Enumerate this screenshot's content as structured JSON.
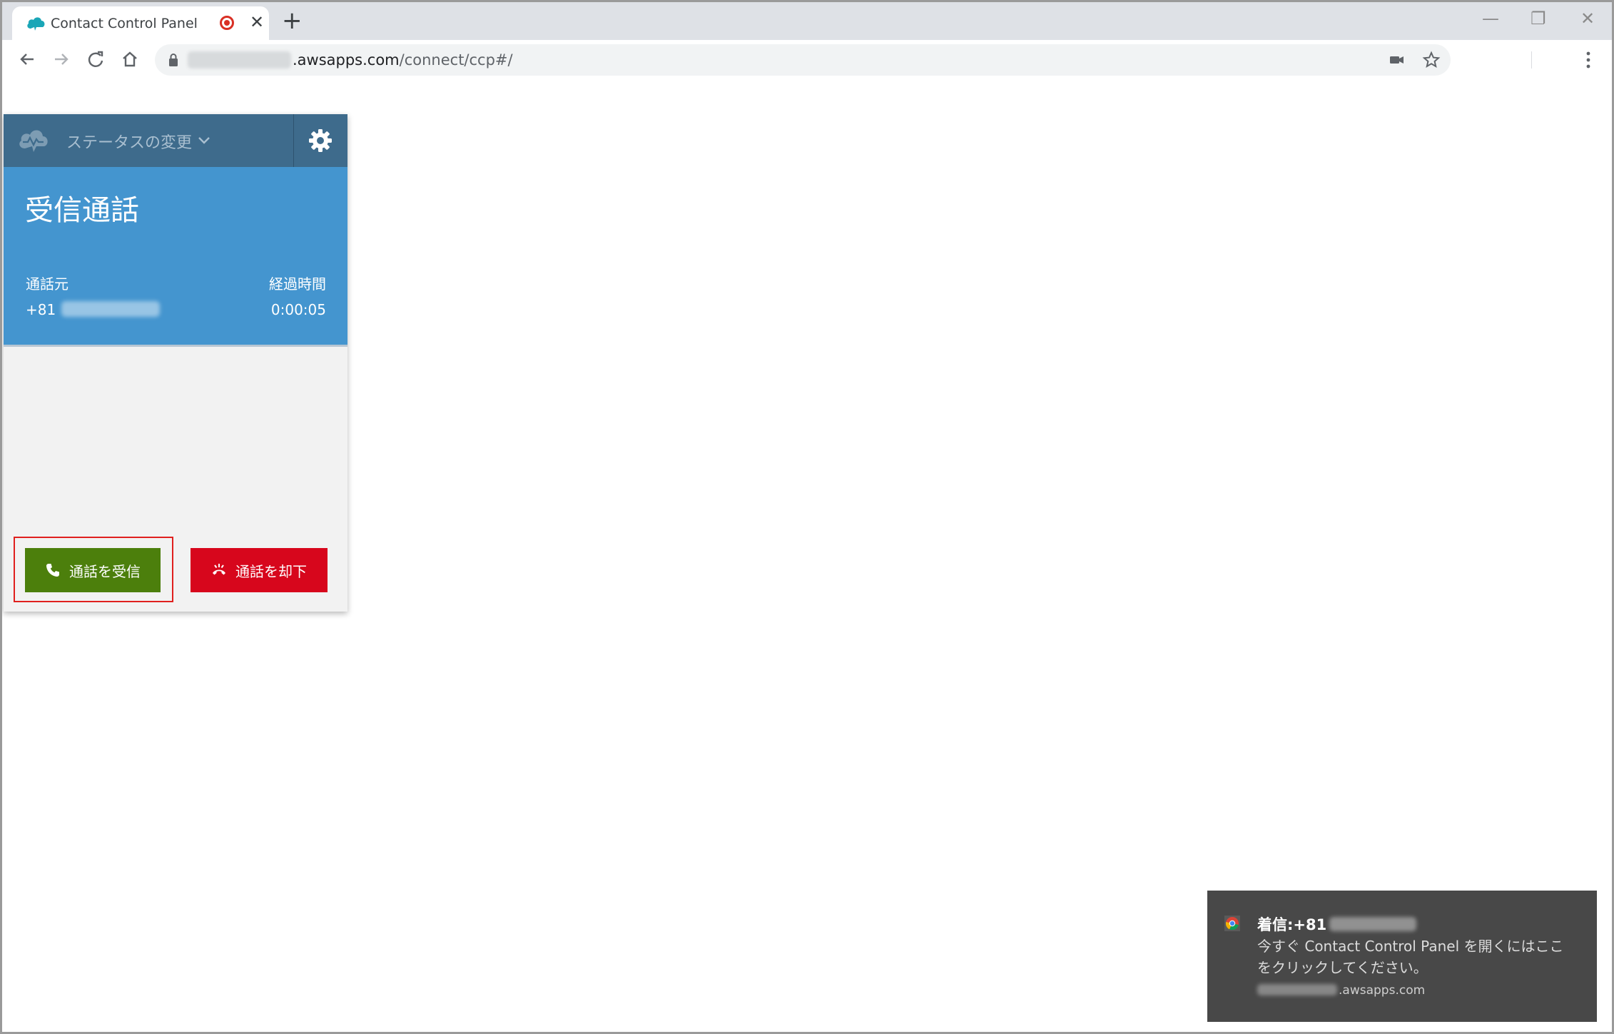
{
  "browser": {
    "tab": {
      "title": "Contact Control Panel",
      "favicon": "aws-connect-cloud-icon",
      "recording_icon": "record-icon",
      "close_icon": "close-icon"
    },
    "new_tab_icon": "plus-icon",
    "window_controls": [
      "minimize-icon",
      "restore-icon",
      "close-icon"
    ],
    "address_bar": {
      "host_blurred": "test-connect1",
      "host": ".awsapps.com",
      "path": "/connect/ccp#/"
    },
    "toolbar_icons": [
      "back-icon",
      "forward-icon",
      "reload-icon",
      "home-icon",
      "lock-icon",
      "camera-icon",
      "star-icon",
      "menu-icon"
    ]
  },
  "ccp": {
    "header": {
      "status_label": "ステータスの変更",
      "settings_icon": "gear-icon"
    },
    "call": {
      "title": "受信通話",
      "from_label": "通話元",
      "from_prefix": "+81",
      "elapsed_label": "経過時間",
      "elapsed_time": "0:00:05"
    },
    "actions": {
      "accept_label": "通話を受信",
      "reject_label": "通話を却下"
    },
    "colors": {
      "header": "#3e6b8c",
      "call_info": "#4495cf",
      "accept": "#4c7f0c",
      "reject": "#d7061c",
      "highlight": "#e0201e"
    }
  },
  "notification": {
    "title_prefix": "着信:+81",
    "body": "今すぐ Contact Control Panel を開くにはここをクリックしてください。",
    "source": ".awsapps.com"
  }
}
